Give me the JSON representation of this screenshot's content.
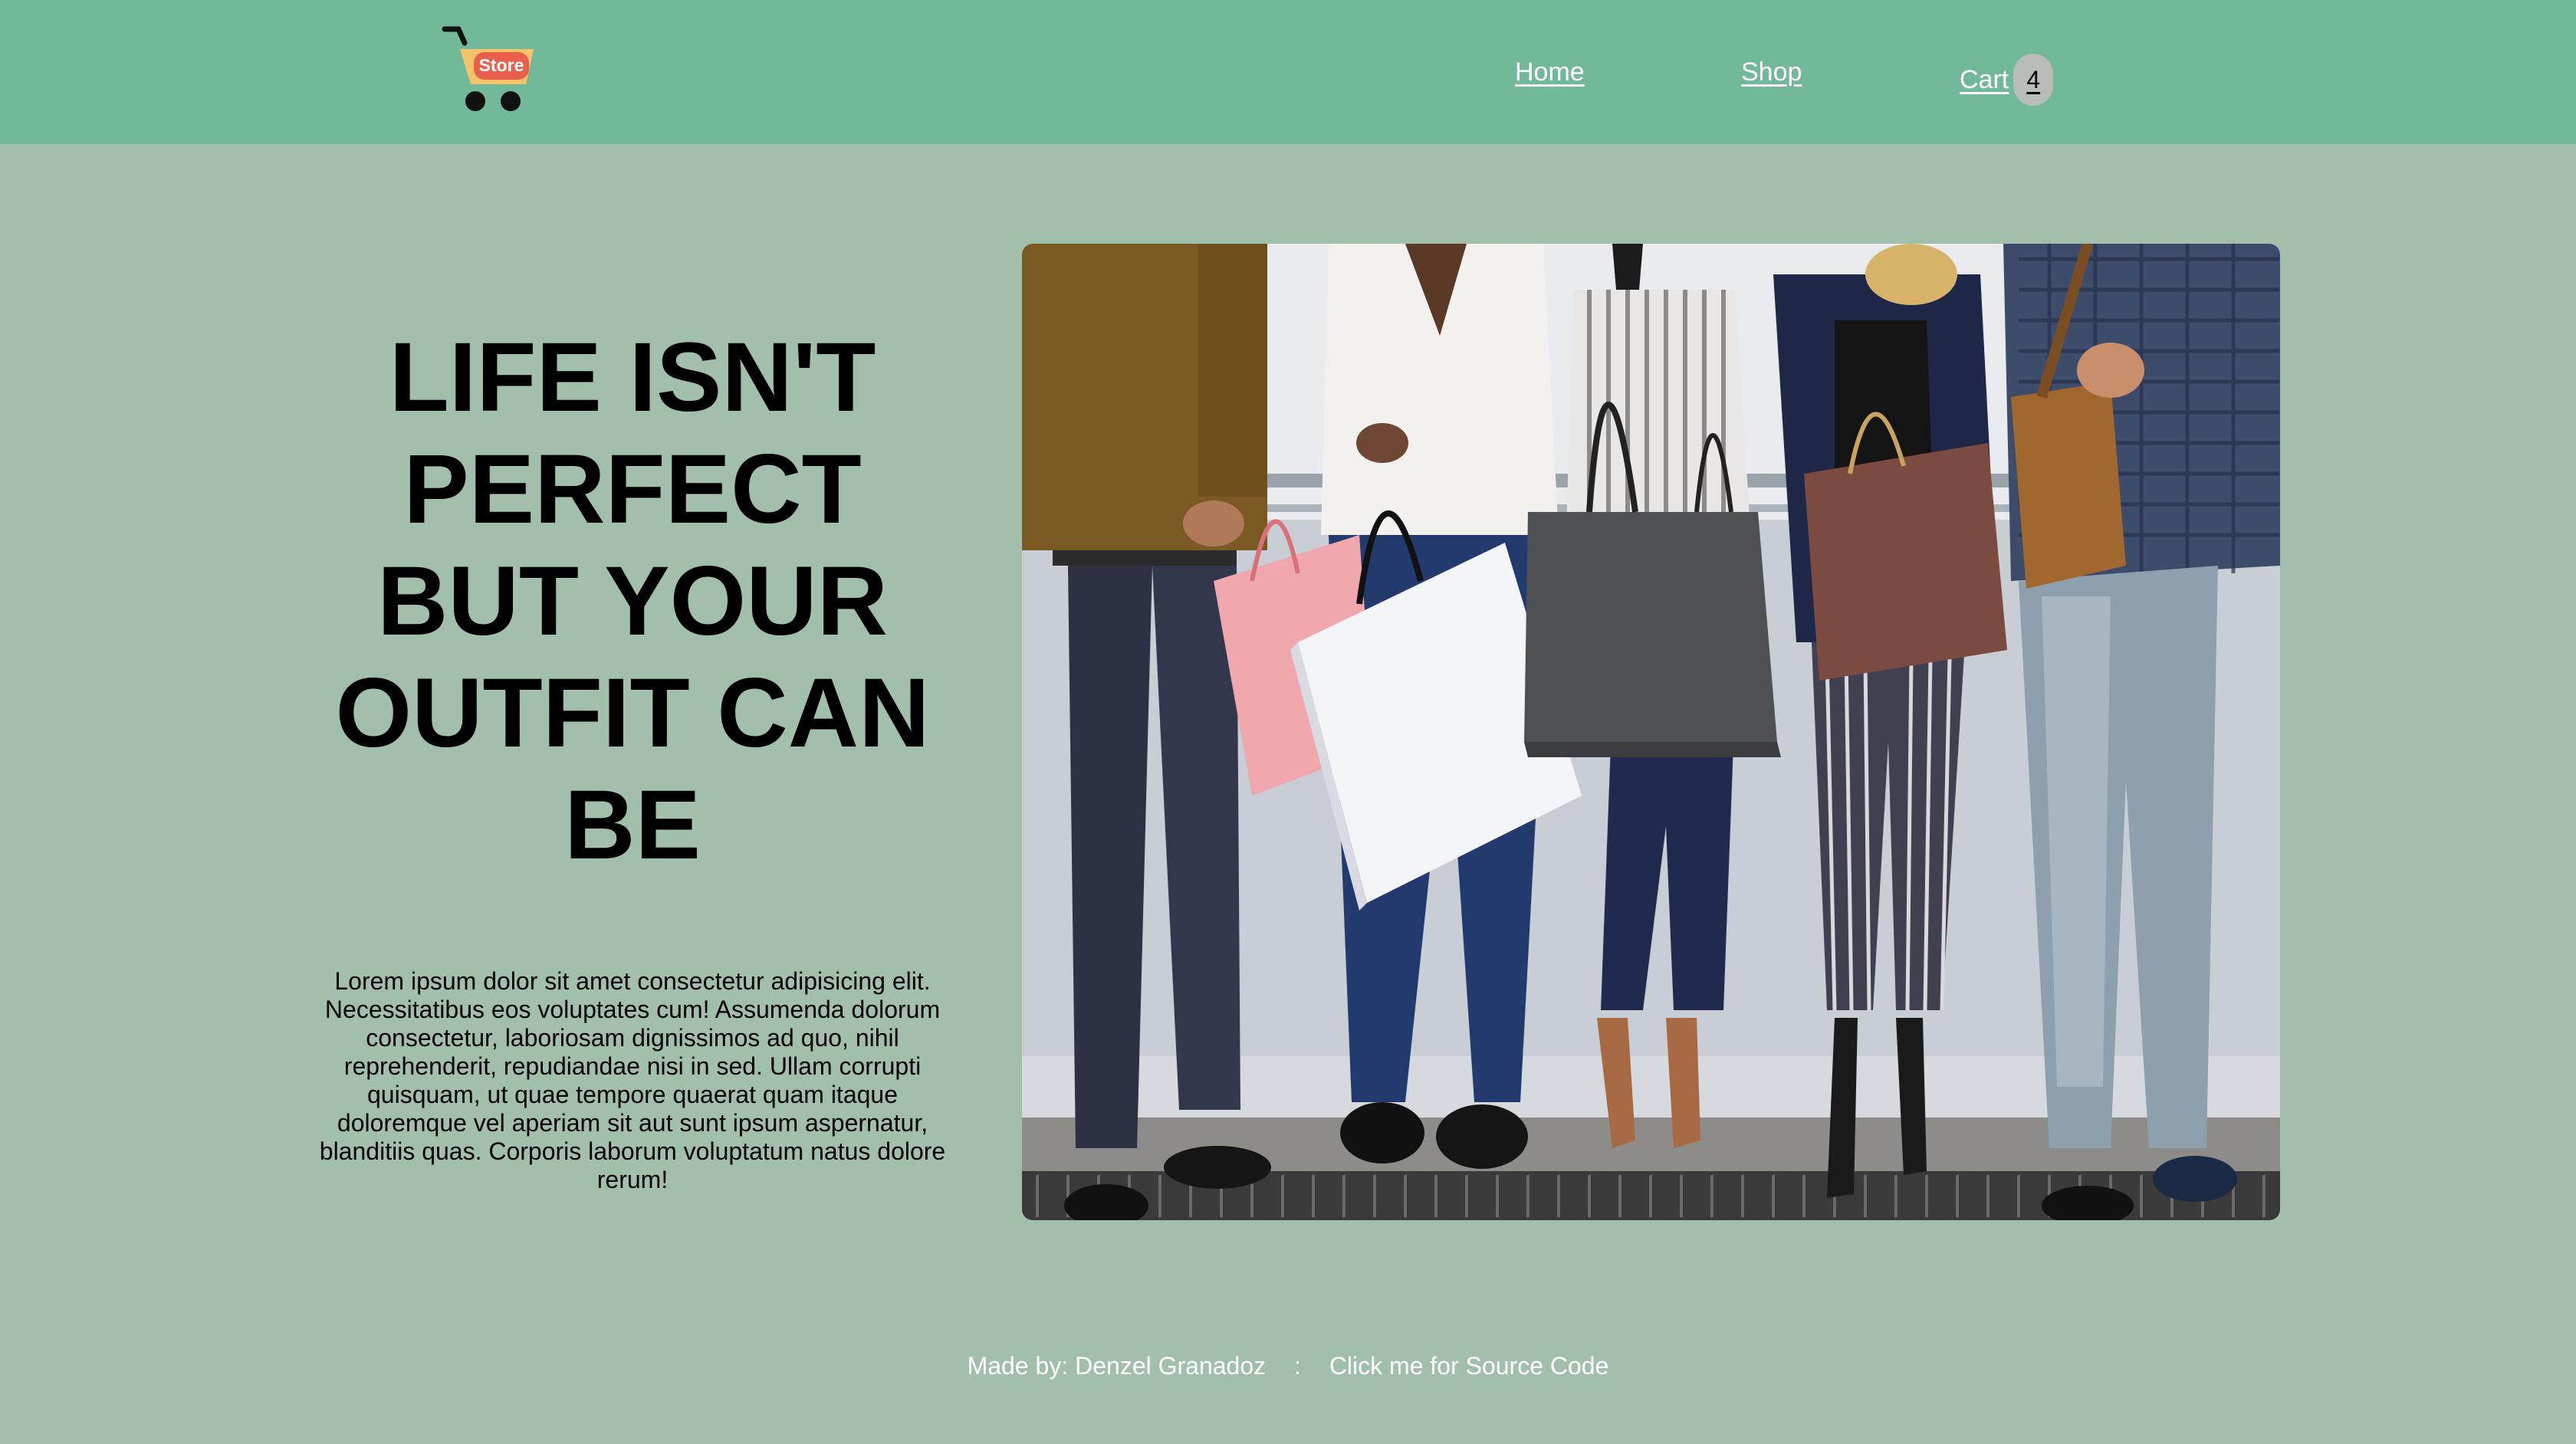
{
  "header": {
    "logo": {
      "icon": "shopping-cart-icon",
      "badge_text": "Store"
    },
    "nav": {
      "home_label": "Home",
      "shop_label": "Shop",
      "cart_label": "Cart",
      "cart_count": "4"
    }
  },
  "hero": {
    "headline_lines": [
      "LIFE ISN'T",
      "PERFECT",
      "BUT YOUR",
      "OUTFIT CAN",
      "BE"
    ],
    "body": "Lorem ipsum dolor sit amet consectetur adipisicing elit. Necessitatibus eos voluptates cum! Assumenda dolorum consectetur, laboriosam dignissimos ad quo, nihil reprehenderit, repudiandae nisi in sed. Ullam corrupti quisquam, ut quae tempore quaerat quam itaque doloremque vel aperiam sit aut sunt ipsum aspernatur, blanditiis quas. Corporis laborum voluptatum natus dolore rerum!"
  },
  "footer": {
    "credit": "Made by: Denzel Granadoz",
    "separator": ":",
    "source_link": "Click me for Source Code"
  },
  "colors": {
    "header_bg": "#72b99a",
    "page_bg": "#a2bfab",
    "logo_badge": "#e8604c",
    "logo_cart": "#f6c36a"
  }
}
